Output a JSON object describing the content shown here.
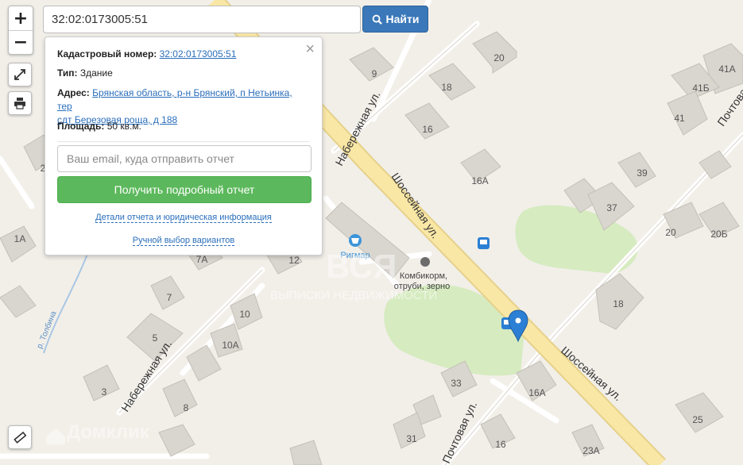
{
  "search": {
    "value": "32:02:0173005:51",
    "button_label": "Найти"
  },
  "zoom": {
    "in_label": "+",
    "out_label": "−"
  },
  "popup": {
    "close_label": "×",
    "cadastral_label": "Кадастровый номер:",
    "cadastral_value": "32:02:0173005:51",
    "type_label": "Тип:",
    "type_value": "Здание",
    "address_label": "Адрес:",
    "address_line1": "Брянская область, р-н Брянский, п Нетьинка, тер",
    "address_line2": "сдт Березовая роща, д 188",
    "area_label": "Площадь:",
    "area_value": "50 кв.м.",
    "email_placeholder": "Ваш email, куда отправить отчет",
    "report_button_label": "Получить подробный отчет",
    "details_link": "Детали отчета и юридическая информация",
    "manual_link": "Ручной выбор вариантов"
  },
  "map": {
    "street_labels": [
      "Набережная ул.",
      "Шоссейная ул.",
      "Набережная ул.",
      "Почтовая ул.",
      "Шоссейная ул.",
      "Почтовая"
    ],
    "river_label": "р. Толбина",
    "poi": {
      "store_name": "Ригмар",
      "shop_line1": "Комбикорм,",
      "shop_line2": "отруби, зерно"
    },
    "house_numbers": [
      "20",
      "41А",
      "9",
      "18",
      "41Б",
      "16",
      "41",
      "16А",
      "39",
      "37",
      "20",
      "20Б",
      "2",
      "1А",
      "7А",
      "12",
      "7",
      "18",
      "10",
      "5",
      "10А",
      "3",
      "8",
      "33",
      "16А",
      "25",
      "31",
      "16",
      "23А"
    ],
    "watermark_brand": "Домклик",
    "watermark_center": "ВСЯ",
    "watermark_sub": "ВЫПИСКИ НЕДВИЖИМОСТИ"
  },
  "colors": {
    "accent": "#3a78b9",
    "report_button": "#5cb85c",
    "link": "#2a6ebb",
    "marker": "#2b7fd4",
    "road": "#f9e7a6",
    "park": "#d8ecc2"
  }
}
